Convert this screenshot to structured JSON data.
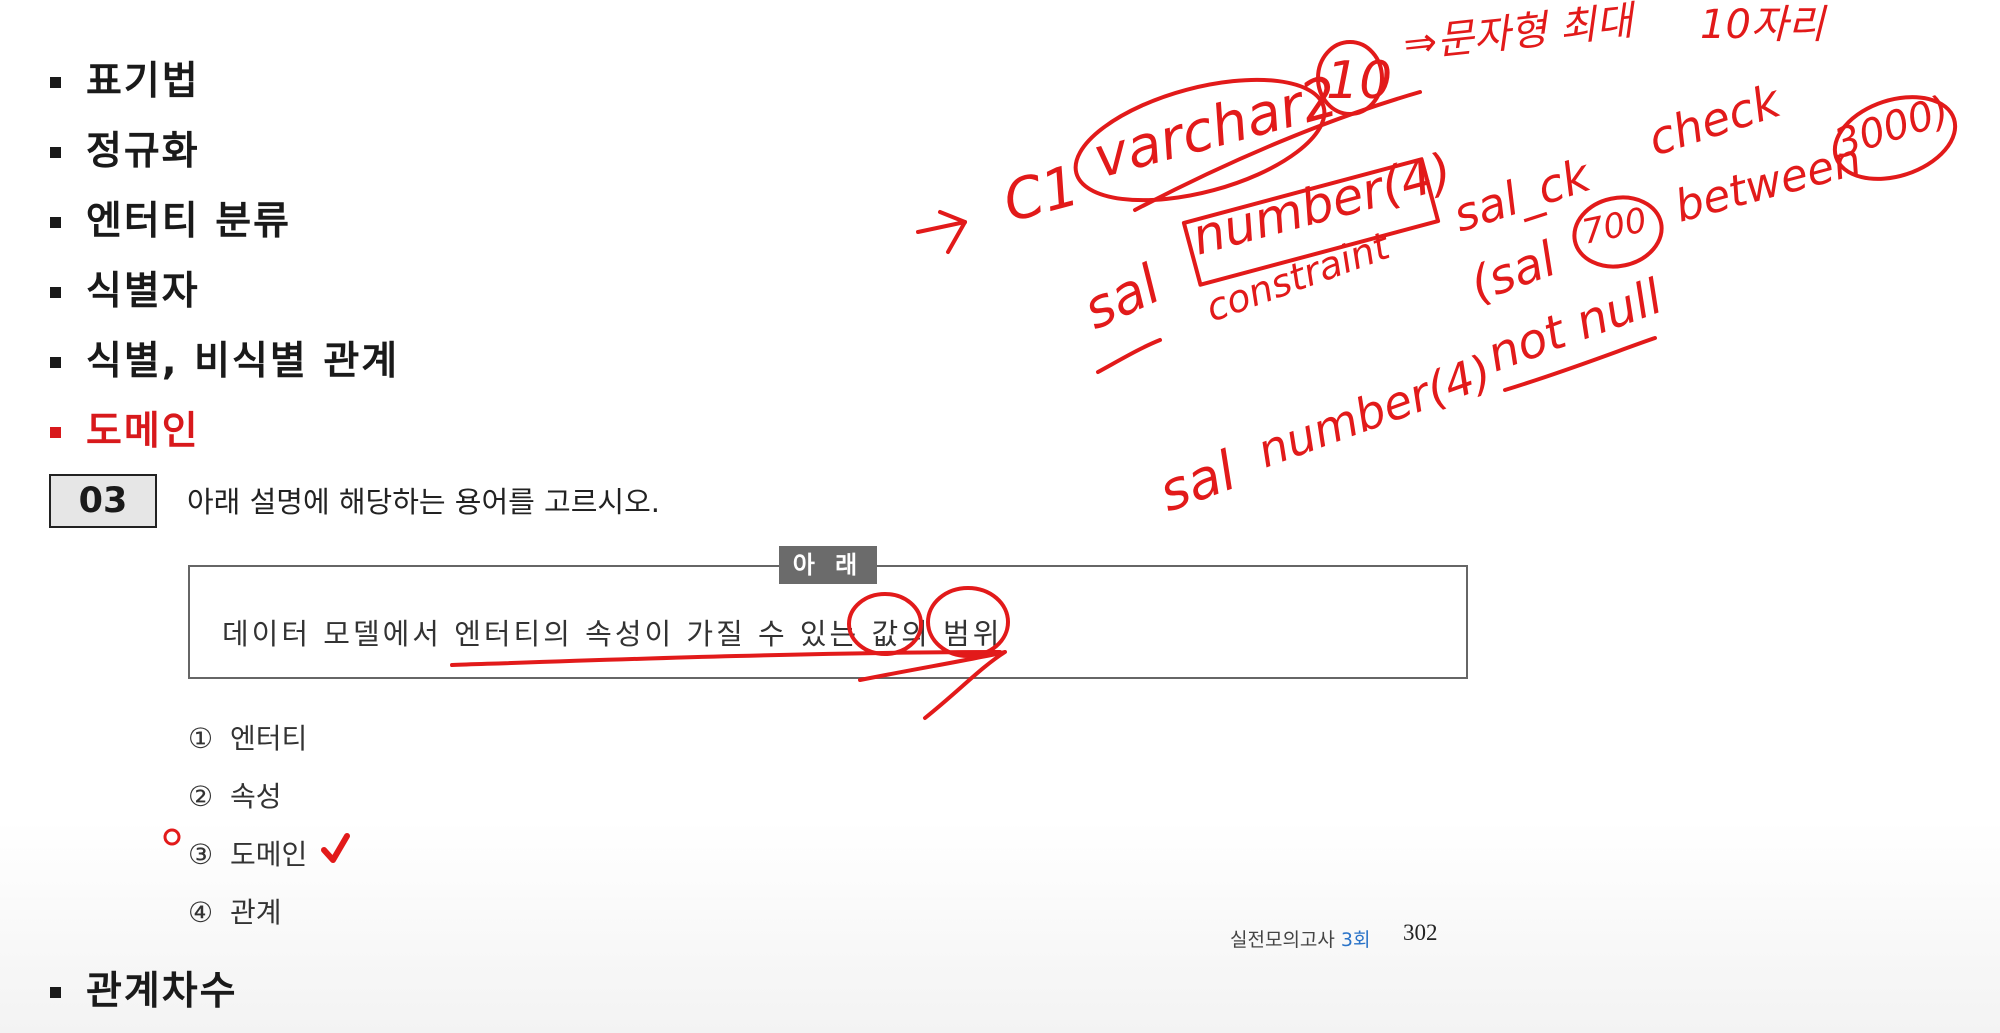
{
  "topics": [
    {
      "label": "표기법"
    },
    {
      "label": "정규화"
    },
    {
      "label": "엔터티 분류"
    },
    {
      "label": "식별자"
    },
    {
      "label": "식별, 비식별 관계"
    },
    {
      "label": "도메인"
    }
  ],
  "bottom_topic": {
    "label": "관계차수"
  },
  "question": {
    "number": "03",
    "prompt": "아래 설명에 해당하는 용어를 고르시오.",
    "box_tag": "아 래",
    "box_text": "데이터 모델에서 엔터티의 속성이 가질 수 있는 값의 범위",
    "options": [
      {
        "num": "①",
        "label": "엔터티"
      },
      {
        "num": "②",
        "label": "속성"
      },
      {
        "num": "③",
        "label": "도메인"
      },
      {
        "num": "④",
        "label": "관계"
      }
    ]
  },
  "footer": {
    "series": "실전모의고사 ",
    "round": "3회",
    "page": "302"
  },
  "handwriting": {
    "line1": "C1 varchar2(10) ⇒ 문자형 최대 10자리",
    "line2": "sal number(4) constraint sal_ck check (sal 700 between 3000)",
    "line3": "sal number(4) not null",
    "label_c1": "C1",
    "label_varchar": "varchar2",
    "label_ten": "10",
    "label_text_type": "⇒문자형 최대",
    "label_ten_chars": "10자리",
    "label_sal": "sal",
    "label_number4": "number(4)",
    "label_constraint": "constraint",
    "label_sal_ck": "sal_ck",
    "label_check": "check",
    "label_sal_paren": "(sal",
    "label_700": "700",
    "label_between": "between",
    "label_3000": "3000)",
    "label_sal2": "sal",
    "label_number4b": "number(4)",
    "label_not_null": "not null"
  },
  "colors": {
    "accent": "#d8191c",
    "ink": "#e21a1a"
  }
}
